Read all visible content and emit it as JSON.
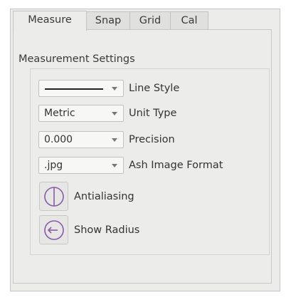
{
  "tabs": {
    "measure": "Measure",
    "snap": "Snap",
    "grid": "Grid",
    "cal": "Cal",
    "active": "Measure"
  },
  "group": {
    "title": "Measurement Settings"
  },
  "rows": {
    "line_style": {
      "value": "",
      "label": "Line Style"
    },
    "unit_type": {
      "value": "Metric",
      "label": "Unit Type"
    },
    "precision": {
      "value": "0.000",
      "label": "Precision"
    },
    "image_format": {
      "value": ".jpg",
      "label": "Ash Image Format"
    }
  },
  "toggles": {
    "antialiasing": {
      "label": "Antialiasing",
      "icon": "antialias-circle-icon"
    },
    "show_radius": {
      "label": "Show Radius",
      "icon": "radius-arrow-icon"
    }
  },
  "colors": {
    "icon_stroke": "#8a5aa8",
    "panel_bg": "#ececea"
  }
}
